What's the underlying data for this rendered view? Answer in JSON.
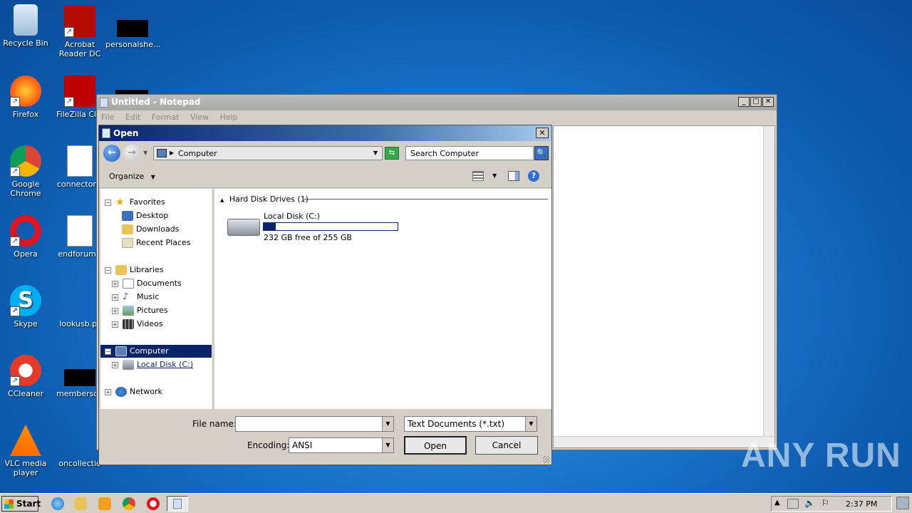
{
  "desktop": {
    "icons": [
      {
        "label": "Recycle Bin"
      },
      {
        "label": "Acrobat Reader DC"
      },
      {
        "label": "personalshe..."
      },
      {
        "label": "Firefox"
      },
      {
        "label": "FileZilla Clie"
      },
      {
        "label": "Google Chrome"
      },
      {
        "label": "connectone"
      },
      {
        "label": "Opera"
      },
      {
        "label": "endforum.r"
      },
      {
        "label": "Skype"
      },
      {
        "label": "lookusb.pr"
      },
      {
        "label": "CCleaner"
      },
      {
        "label": "membersop"
      },
      {
        "label": "VLC media player"
      },
      {
        "label": "oncollectio"
      }
    ]
  },
  "notepad": {
    "title": "Untitled - Notepad",
    "menu": [
      "File",
      "Edit",
      "Format",
      "View",
      "Help"
    ]
  },
  "dialog": {
    "title": "Open",
    "address": "Computer",
    "search_placeholder": "Search Computer",
    "organize_label": "Organize",
    "tree": {
      "favorites": "Favorites",
      "desktop": "Desktop",
      "downloads": "Downloads",
      "recent_places": "Recent Places",
      "libraries": "Libraries",
      "documents": "Documents",
      "music": "Music",
      "pictures": "Pictures",
      "videos": "Videos",
      "computer": "Computer",
      "local_disk": "Local Disk (C:)",
      "network": "Network"
    },
    "group_header": "Hard Disk Drives (1)",
    "drive": {
      "name": "Local Disk (C:)",
      "free_text": "232 GB free of 255 GB",
      "used_fraction": 0.09
    },
    "file_name_label": "File name:",
    "file_name_value": "",
    "file_type": "Text Documents (*.txt)",
    "encoding_label": "Encoding:",
    "encoding_value": "ANSI",
    "open_label": "Open",
    "cancel_label": "Cancel"
  },
  "taskbar": {
    "start_label": "Start",
    "clock": "2:37 PM"
  },
  "watermark": "ANY RUN"
}
